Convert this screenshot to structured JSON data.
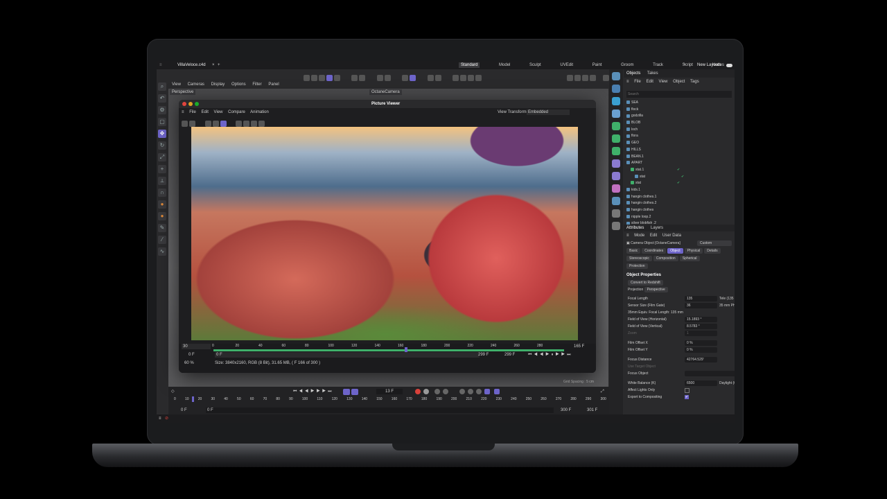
{
  "app": {
    "file_tab": "VillaVeloce.c4d",
    "layouts": [
      "Standard",
      "Model",
      "Sculpt",
      "UVEdit",
      "Paint",
      "Groom",
      "Track",
      "Script",
      "Nodes"
    ],
    "new_layouts": "New Layouts"
  },
  "viewport": {
    "menus": [
      "View",
      "Cameras",
      "Display",
      "Options",
      "Filter",
      "Panel"
    ],
    "label": "Perspective",
    "camera": "OctaneCamera",
    "grid": "Grid Spacing : 5 cm"
  },
  "picture_viewer": {
    "title": "Picture Viewer",
    "menus": [
      "File",
      "Edit",
      "View",
      "Compare",
      "Animation"
    ],
    "view_transform_label": "View Transform",
    "view_transform_value": "Embedded",
    "frame_ticks": [
      "0",
      "20",
      "40",
      "60",
      "80",
      "100",
      "120",
      "140",
      "160",
      "180",
      "200",
      "220",
      "240",
      "260",
      "280",
      "300"
    ],
    "left_field": "30",
    "start_frame": "0 F",
    "start_frame2": "0 F",
    "end_frame": "299 F",
    "end_frame2": "299 F",
    "current_frame": "165 F",
    "zoom": "60 %",
    "info": "Size: 3840x2160, RGB (8 Bit), 31.65 MB, ( F 166 of 300 )"
  },
  "objects_panel": {
    "tabs": [
      "Objects",
      "Takes"
    ],
    "menus": [
      "File",
      "Edit",
      "View",
      "Object",
      "Tags"
    ],
    "search_placeholder": "Search",
    "items": [
      "SEA",
      "flock",
      "godzilla",
      "BLOB",
      "loch",
      "flora",
      "GEO",
      "HILLS",
      "BEAN.1",
      "APART",
      "stat.1",
      "stat",
      "stat",
      "kids.1",
      "hangin clothes.1",
      "hangin clothes.2",
      "hangin clothes",
      "nipple loop.2",
      "silver blobfish .2"
    ]
  },
  "attributes_panel": {
    "tabs": [
      "Attributes",
      "Layers"
    ],
    "menus": [
      "Mode",
      "Edit",
      "User Data"
    ],
    "object_label": "Camera Object [OctaneCamera]",
    "preset": "Custom",
    "sub_tabs": [
      "Basic",
      "Coordinates",
      "Object",
      "Physical",
      "Details",
      "Stereoscopic",
      "Composition",
      "Spherical",
      "Protection"
    ],
    "section": "Object Properties",
    "convert_btn": "Convert to Redshift",
    "projection_label": "Projection",
    "projection_value": "Perspective",
    "rows": [
      {
        "label": "Focal Length",
        "value": "135",
        "extra": "Tele (135 mm"
      },
      {
        "label": "Sensor Size (Film Gate)",
        "value": "36",
        "extra": "35 mm Photo"
      },
      {
        "label": "35mm Equiv. Focal Length:",
        "value": "135 mm",
        "extra": ""
      },
      {
        "label": "Field of View (Horizontal)",
        "value": "15.1893 °",
        "extra": ""
      },
      {
        "label": "Field of View (Vertical)",
        "value": "8.5783 °",
        "extra": ""
      },
      {
        "label": "Zoom",
        "value": "1",
        "extra": ""
      },
      {
        "label": "Film Offset X",
        "value": "0 %",
        "extra": ""
      },
      {
        "label": "Film Offset Y",
        "value": "0 %",
        "extra": ""
      },
      {
        "label": "Focus Distance",
        "value": "42764.529'",
        "extra": ""
      },
      {
        "label": "Use Target Object",
        "value": "",
        "extra": ""
      },
      {
        "label": "Focus Object",
        "value": "",
        "extra": ""
      },
      {
        "label": "White Balance (K)",
        "value": "6500",
        "extra": "Daylight (65"
      },
      {
        "label": "Affect Lights Only",
        "value": "",
        "extra": ""
      },
      {
        "label": "Export to Compositing",
        "value": "",
        "extra": ""
      }
    ]
  },
  "timeline": {
    "ticks": [
      "0",
      "10",
      "20",
      "30",
      "40",
      "50",
      "60",
      "70",
      "80",
      "90",
      "100",
      "110",
      "120",
      "130",
      "140",
      "150",
      "160",
      "170",
      "180",
      "190",
      "200",
      "210",
      "220",
      "230",
      "240",
      "250",
      "260",
      "270",
      "280",
      "290",
      "300"
    ],
    "current": "13 F",
    "start": "0 F",
    "start2": "0 F",
    "end": "300 F",
    "end2": "301 F"
  },
  "colors": {
    "accent": "#6d64c9",
    "record": "#d9413a",
    "green": "#3fb06a"
  }
}
